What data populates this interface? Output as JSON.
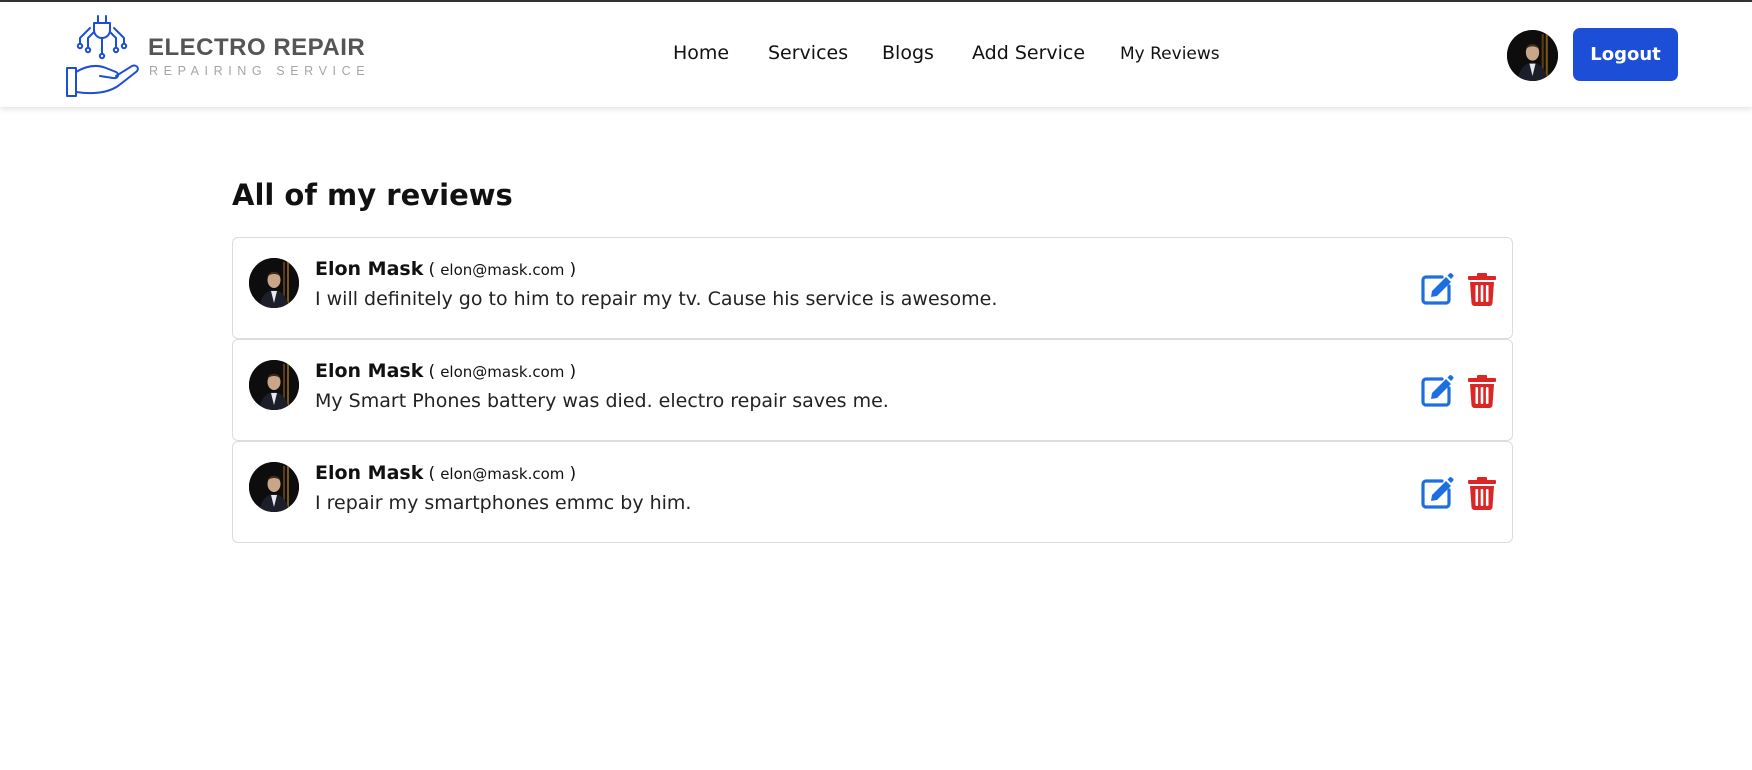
{
  "brand": {
    "title": "ELECTRO REPAIR",
    "subtitle": "REPAIRING SERVICE",
    "logo_icon": "hand-plug-circuit-icon",
    "color": "#1d4ed8"
  },
  "nav": {
    "items": [
      {
        "label": "Home"
      },
      {
        "label": "Services"
      },
      {
        "label": "Blogs"
      },
      {
        "label": "Add Service"
      },
      {
        "label": "My Reviews"
      }
    ]
  },
  "header": {
    "avatar_icon": "user-avatar",
    "logout_label": "Logout",
    "accent": "#1d4ed8"
  },
  "main": {
    "title": "All of my reviews",
    "reviews": [
      {
        "name": "Elon Mask",
        "open_paren": "(",
        "email": "elon@mask.com",
        "close_paren": ")",
        "text": "I will definitely go to him to repair my tv. Cause his service is awesome."
      },
      {
        "name": "Elon Mask",
        "open_paren": "(",
        "email": "elon@mask.com",
        "close_paren": ")",
        "text": "My Smart Phones battery was died. electro repair saves me."
      },
      {
        "name": "Elon Mask",
        "open_paren": "(",
        "email": "elon@mask.com",
        "close_paren": ")",
        "text": "I repair my smartphones emmc by him."
      }
    ],
    "edit_icon": "edit-icon",
    "delete_icon": "trash-icon",
    "edit_color": "#1d6fe0",
    "delete_color": "#dc2626"
  }
}
